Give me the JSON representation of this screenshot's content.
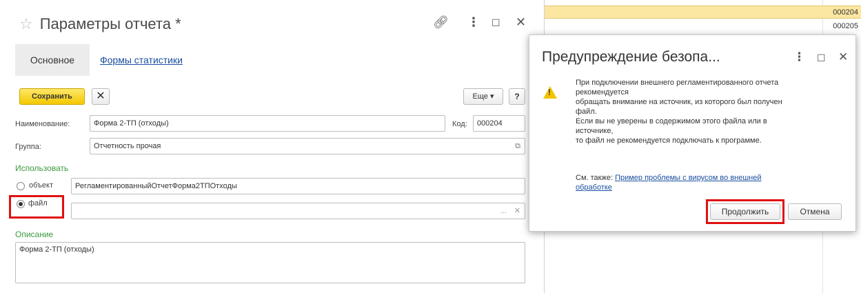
{
  "background_list": {
    "codes": [
      "000204",
      "000205"
    ]
  },
  "form": {
    "title": "Параметры отчета *",
    "tabs": {
      "main": "Основное",
      "stats": "Формы статистики"
    },
    "toolbar": {
      "save": "Сохранить",
      "close_icon": "✕",
      "more": "Еще ▾",
      "help": "?"
    },
    "name_label": "Наименование:",
    "name_value": "Форма 2-ТП (отходы)",
    "code_label": "Код:",
    "code_value": "000204",
    "group_label": "Группа:",
    "group_value": "Отчетность прочая",
    "use_label": "Использовать",
    "object_label": "объект",
    "object_value": "РегламентированныйОтчетФорма2ТПОтходы",
    "file_label": "файл",
    "file_value": "",
    "desc_label": "Описание",
    "desc_value": "Форма 2-ТП (отходы)"
  },
  "dialog": {
    "title": "Предупреждение безопа...",
    "message_lines": [
      "При подключении внешнего регламентированного отчета",
      "рекомендуется",
      "обращать внимание на источник, из которого был получен",
      "файл.",
      "Если вы не уверены в содержимом этого файла или в",
      "источнике,",
      "то файл не рекомендуется подключать к программе."
    ],
    "see_also_prefix": "См. также:",
    "see_also_link_1": "Пример проблемы с вирусом во внешней",
    "see_also_link_2": "обработке",
    "continue": "Продолжить",
    "cancel": "Отмена"
  }
}
